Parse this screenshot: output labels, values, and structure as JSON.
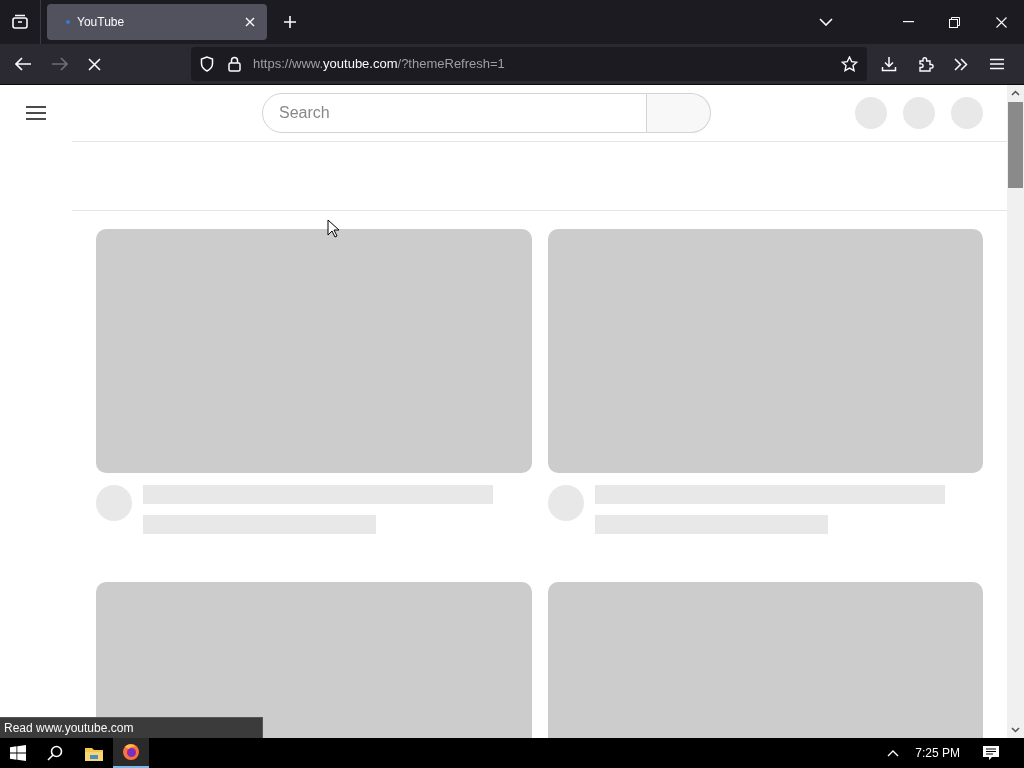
{
  "browser": {
    "tabs": [
      {
        "title": "YouTube",
        "selected": true
      }
    ],
    "address": {
      "parts": [
        {
          "text": "https://www.",
          "kind": "dim"
        },
        {
          "text": "youtube.com",
          "kind": "host"
        },
        {
          "text": "/?themeRefresh=1",
          "kind": "dim"
        }
      ]
    }
  },
  "page": {
    "search": {
      "placeholder": "Search"
    },
    "cards": [
      {
        "kind": "skeleton"
      },
      {
        "kind": "skeleton"
      },
      {
        "kind": "skeleton_thumbnail"
      },
      {
        "kind": "skeleton_thumbnail"
      }
    ]
  },
  "status_text": "Read www.youtube.com",
  "taskbar": {
    "clock": "7:25 PM"
  }
}
